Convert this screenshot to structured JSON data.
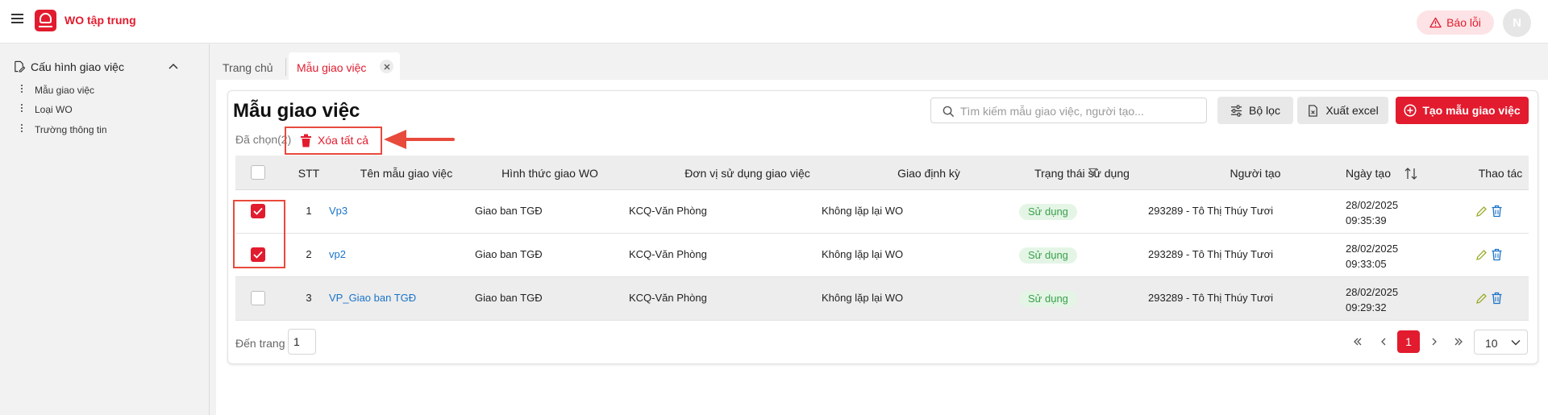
{
  "header": {
    "app_title": "WO tập trung",
    "report_label": "Báo lỗi",
    "avatar_initial": "N",
    "brand_color": "#e21b2e"
  },
  "sidebar": {
    "group_label": "Cấu hình giao việc",
    "items": [
      {
        "label": "Mẫu giao việc"
      },
      {
        "label": "Loại WO"
      },
      {
        "label": "Trường thông tin"
      }
    ]
  },
  "tabs": [
    {
      "label": "Trang chủ"
    },
    {
      "label": "Mẫu giao việc",
      "active": true
    }
  ],
  "main": {
    "title": "Mẫu giao việc",
    "search_placeholder": "Tìm kiếm mẫu giao việc, người tạo...",
    "filter_label": "Bộ lọc",
    "export_label": "Xuất excel",
    "create_label": "Tạo mẫu giao việc",
    "selected_text": "Đã chọn(2)",
    "delete_all_label": "Xóa tất cả"
  },
  "table": {
    "columns": [
      "STT",
      "Tên mẫu giao việc",
      "Hình thức giao WO",
      "Đơn vị sử dụng giao việc",
      "Giao định kỳ",
      "Trạng thái sử dụng",
      "Người tạo",
      "Ngày tạo",
      "Thao tác"
    ],
    "rows": [
      {
        "checked": true,
        "stt": "1",
        "name": "Vp3",
        "form": "Giao ban TGĐ",
        "unit": "KCQ-Văn Phòng",
        "periodic": "Không lặp lại WO",
        "status": "Sử dụng",
        "creator": "293289 - Tô Thị Thúy Tươi",
        "date": "28/02/2025",
        "time": "09:35:39"
      },
      {
        "checked": true,
        "stt": "2",
        "name": "vp2",
        "form": "Giao ban TGĐ",
        "unit": "KCQ-Văn Phòng",
        "periodic": "Không lặp lại WO",
        "status": "Sử dụng",
        "creator": "293289 - Tô Thị Thúy Tươi",
        "date": "28/02/2025",
        "time": "09:33:05"
      },
      {
        "checked": false,
        "stt": "3",
        "name": "VP_Giao ban TGĐ",
        "form": "Giao ban TGĐ",
        "unit": "KCQ-Văn Phòng",
        "periodic": "Không lặp lại WO",
        "status": "Sử dụng",
        "creator": "293289 - Tô Thị Thúy Tươi",
        "date": "28/02/2025",
        "time": "09:29:32"
      }
    ]
  },
  "pagination": {
    "goto_label": "Đến trang",
    "goto_value": "1",
    "current_page": "1",
    "page_size": "10"
  }
}
